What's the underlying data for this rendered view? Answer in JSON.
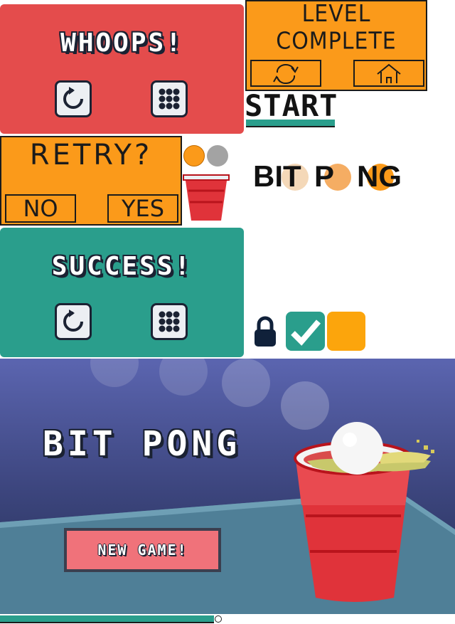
{
  "colors": {
    "red_panel": "#e44c4c",
    "teal": "#2a9e8c",
    "orange": "#fb9a1a",
    "navy": "#1b2233",
    "cup_red": "#e0333a",
    "sky_top": "#5b65b0",
    "sky_bottom": "#242f52",
    "table": "#4f7f97"
  },
  "whoops_panel": {
    "title": "WHOOPS!",
    "retry_icon": "retry-arrow-icon",
    "menu_icon": "grid-menu-icon"
  },
  "level_complete_sheet": {
    "title": "LEVEL COMPLETE",
    "left_icon": "refresh-sketch-icon",
    "right_icon": "home-sketch-icon"
  },
  "start_label": {
    "text": "START"
  },
  "retry_sheet": {
    "title": "RETRY?",
    "no_label": "NO",
    "yes_label": "YES"
  },
  "bitpong_small_logo": {
    "left": "BIT",
    "p": "P",
    "ng": "NG"
  },
  "success_panel": {
    "title": "SUCCESS!",
    "retry_icon": "retry-arrow-icon",
    "menu_icon": "grid-menu-icon"
  },
  "level_icons": {
    "locked": "lock-icon",
    "completed": "checkmark-icon",
    "open": "orange-square"
  },
  "title_screen": {
    "title": "BIT PONG",
    "new_game_label": "NEW GAME!"
  },
  "progress": {
    "fraction": 0.47
  }
}
